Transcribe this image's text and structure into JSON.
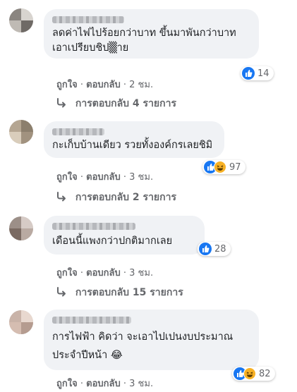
{
  "colors": {
    "like": "#1877f2",
    "haha": "#f7b125",
    "bubble": "#f0f2f5",
    "meta": "#65676b"
  },
  "actions": {
    "like": "ถูกใจ",
    "sep": "·",
    "reply": "ตอบกลับ"
  },
  "comments": [
    {
      "text_lines": [
        "ลดค่าไฟไปร้อยกว่าบาท ขึ้นมาพันกว่าบาท",
        "เอาเปรียบชิป▒าย"
      ],
      "time": "2 ชม.",
      "reaction_count": "14",
      "reaction_icons": [
        "like-icon"
      ],
      "replies": "การตอบกลับ 4 รายการ"
    },
    {
      "text_lines": [
        "กะเก็บบ้านเดียว รวยทั้งองค์กรเลยชิมิ"
      ],
      "time": "3 ชม.",
      "reaction_count": "97",
      "reaction_icons": [
        "like-icon",
        "haha-icon"
      ],
      "replies": "การตอบกลับ 2 รายการ"
    },
    {
      "text_lines": [
        "เดือนนี้แพงกว่าปกติมากเลย"
      ],
      "time": "3 ชม.",
      "reaction_count": "28",
      "reaction_icons": [
        "like-icon"
      ],
      "replies": "การตอบกลับ 15 รายการ"
    },
    {
      "text_lines": [
        "การไฟฟ้า คิดว่า จะเอาไปเปนงบประมาณ",
        "ประจำปีหน้า 😂"
      ],
      "time": "3 ชม.",
      "reaction_count": "82",
      "reaction_icons": [
        "like-icon",
        "haha-icon"
      ]
    }
  ]
}
